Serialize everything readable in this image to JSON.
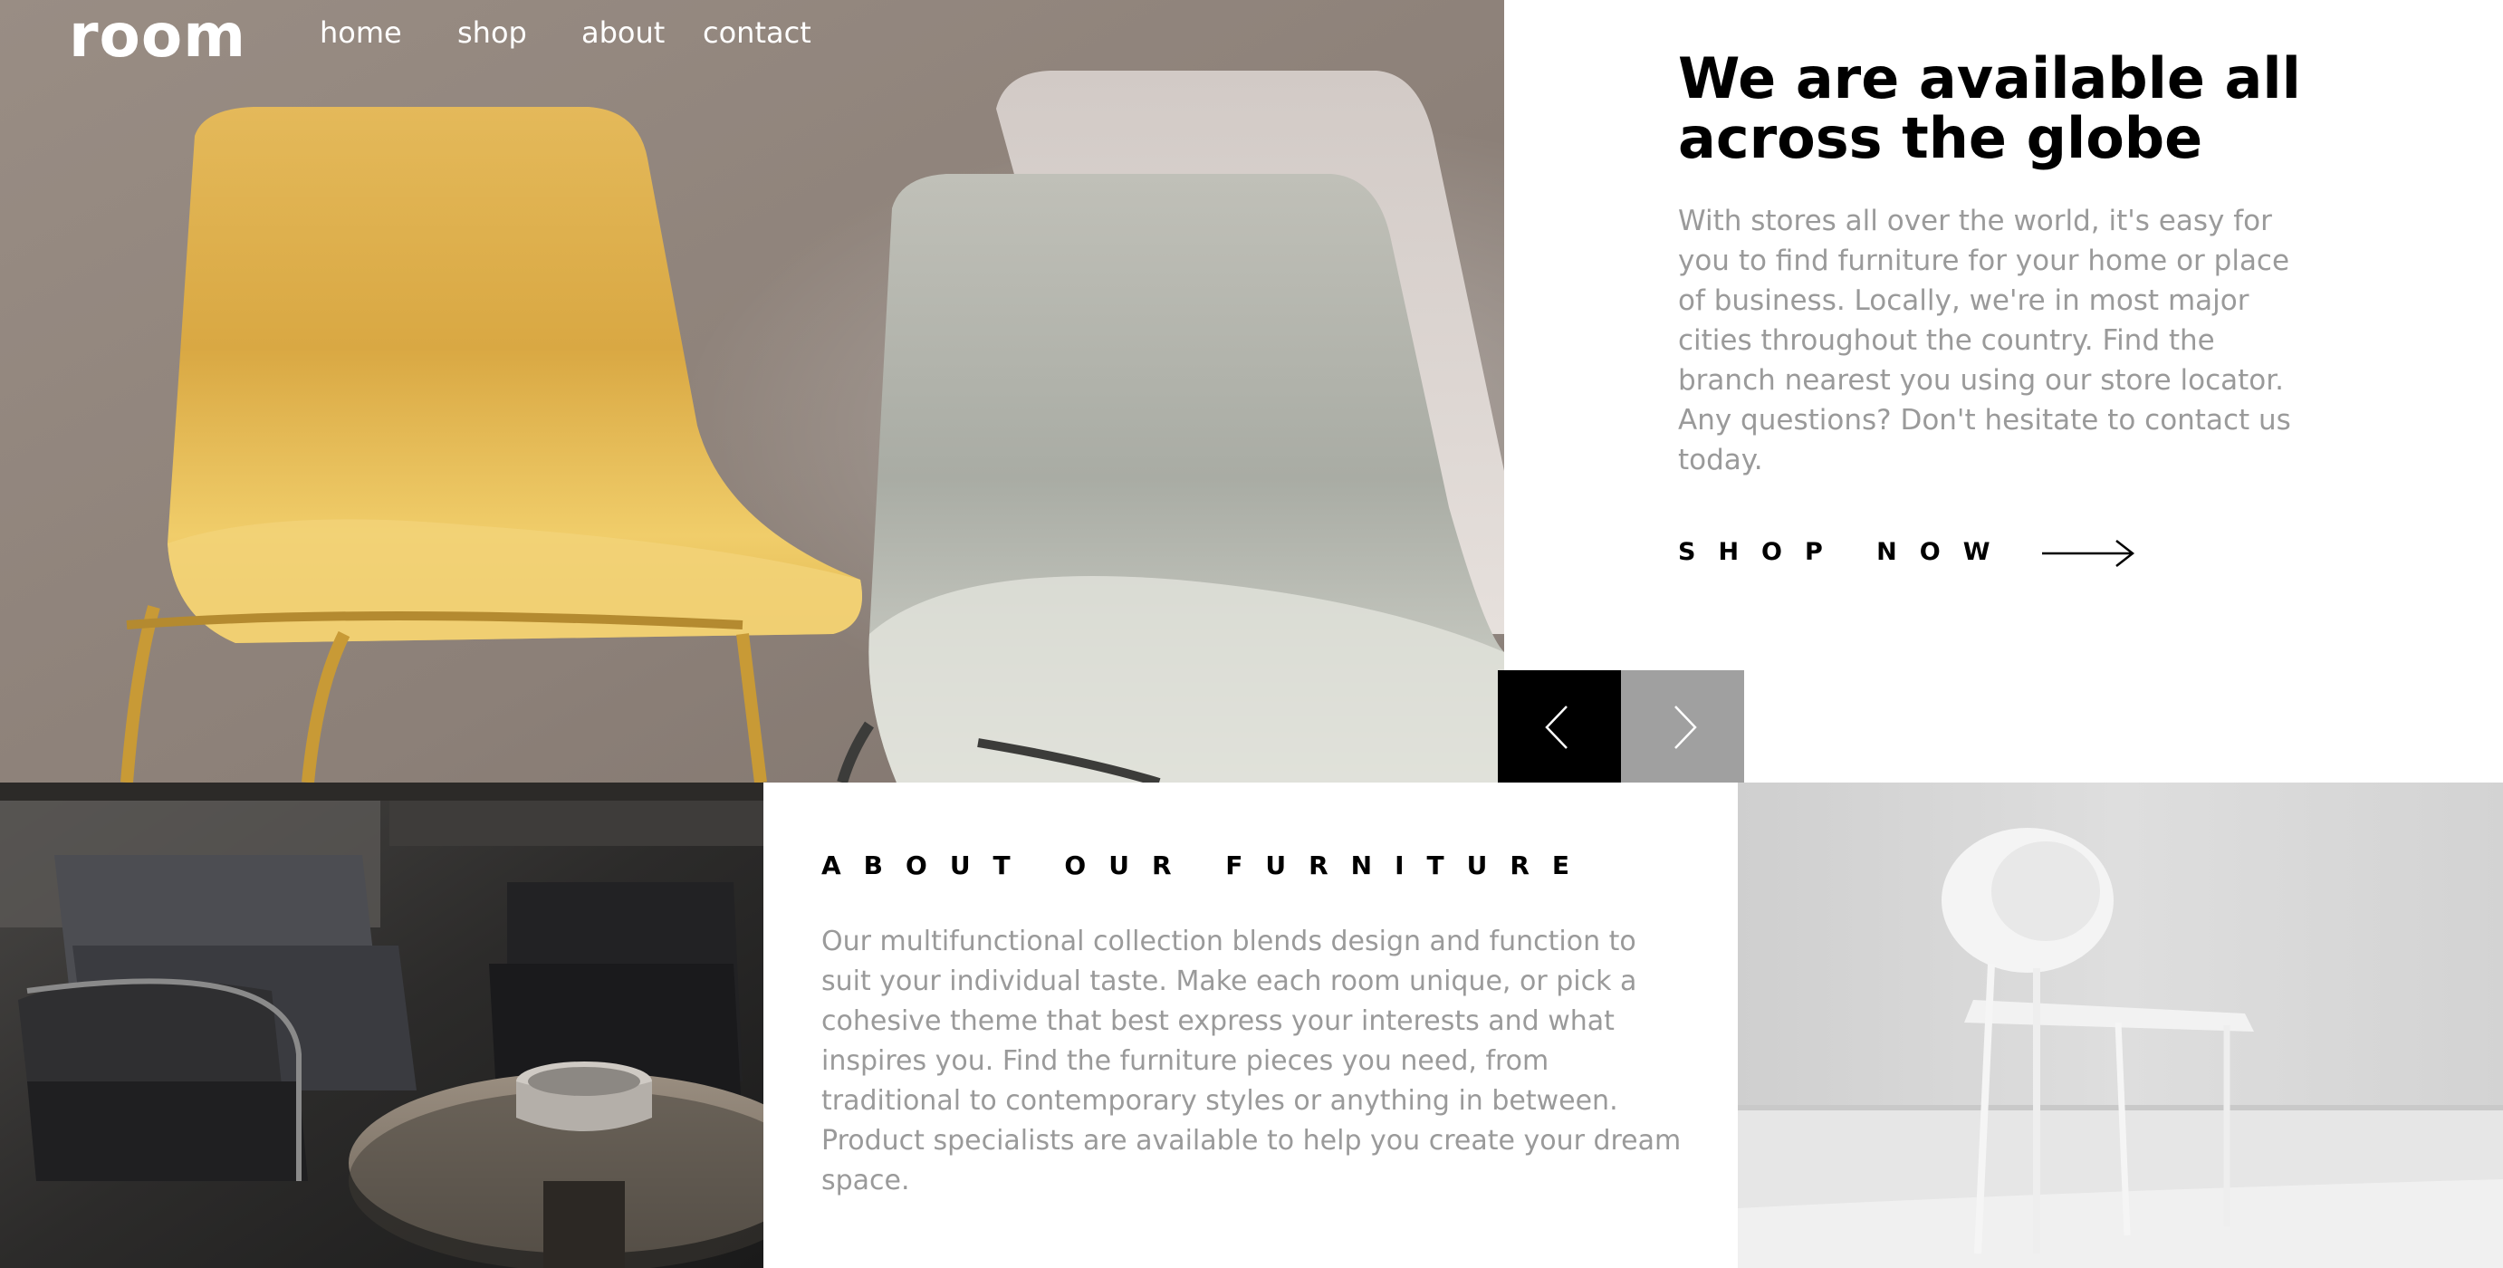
{
  "nav": {
    "logo": "room",
    "links": [
      "home",
      "shop",
      "about",
      "contact"
    ]
  },
  "hero": {
    "image": "yellow-and-white-chairs-photo",
    "title": "We are available all across the globe",
    "body": "With stores all over the world, it's easy for you to find furniture for your home or place of business. Locally, we're in most major cities throughout the country. Find the branch nearest you using our store locator. Any questions? Don't hesitate to contact us today.",
    "cta_label": "SHOP NOW",
    "cta_icon": "arrow-right-icon"
  },
  "slider": {
    "prev_icon": "chevron-left-icon",
    "next_icon": "chevron-right-icon",
    "prev_bg": "#000000",
    "next_bg": "#a0a0a0"
  },
  "about": {
    "heading": "ABOUT OUR FURNITURE",
    "body": "Our multifunctional collection blends design and function to suit your individual taste. Make each room unique, or pick a cohesive theme that best express your interests and what inspires you. Find the furniture pieces you need, from traditional to contemporary styles or anything in between. Product specialists are available to help you create your dream space.",
    "image_left": "dark-living-room-photo",
    "image_right": "white-chair-photo"
  },
  "colors": {
    "text_dark": "#000000",
    "text_muted": "#9a9a9a",
    "white": "#ffffff"
  }
}
